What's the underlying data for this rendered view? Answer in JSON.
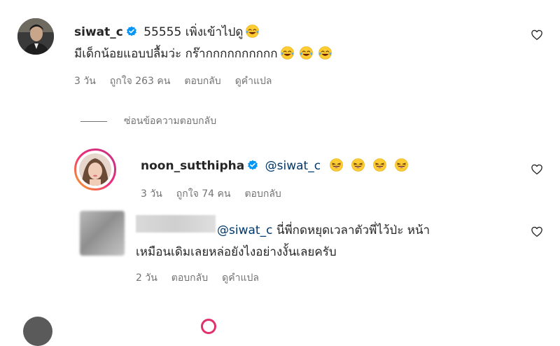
{
  "colors": {
    "mention": "#00376b",
    "meta": "#737373",
    "verified": "#0095f6",
    "story_ring_start": "#f9a825",
    "story_ring_end": "#d62976"
  },
  "comment1": {
    "username": "siwat_c",
    "line1": "55555 เพิ่งเข้าไปดู",
    "line2": "มีเด็กน้อยแอบปลื้มว่ะ กร๊ากกกกกกกกกก",
    "time": "3 วัน",
    "likes": "ถูกใจ 263 คน",
    "reply": "ตอบกลับ",
    "translate": "ดูคำแปล"
  },
  "hide_replies": "ซ่อนข้อความตอบกลับ",
  "reply1": {
    "username": "noon_sutthipha",
    "mention": "@siwat_c",
    "time": "3 วัน",
    "likes": "ถูกใจ 74 คน",
    "reply": "ตอบกลับ"
  },
  "reply2": {
    "mention": "@siwat_c",
    "line1": " นี่พี่กดหยุดเวลาตัวพี่ไว้ป่ะ หน้า",
    "line2": "เหมือนเดิมเลยหล่อยังไงอย่างงั้นเลยครับ",
    "time": "2 วัน",
    "reply": "ตอบกลับ",
    "translate": "ดูคำแปล"
  },
  "icons": {
    "heart": "heart-icon",
    "verified": "verified-badge-icon",
    "emoji": "laughing-emoji-icon"
  }
}
